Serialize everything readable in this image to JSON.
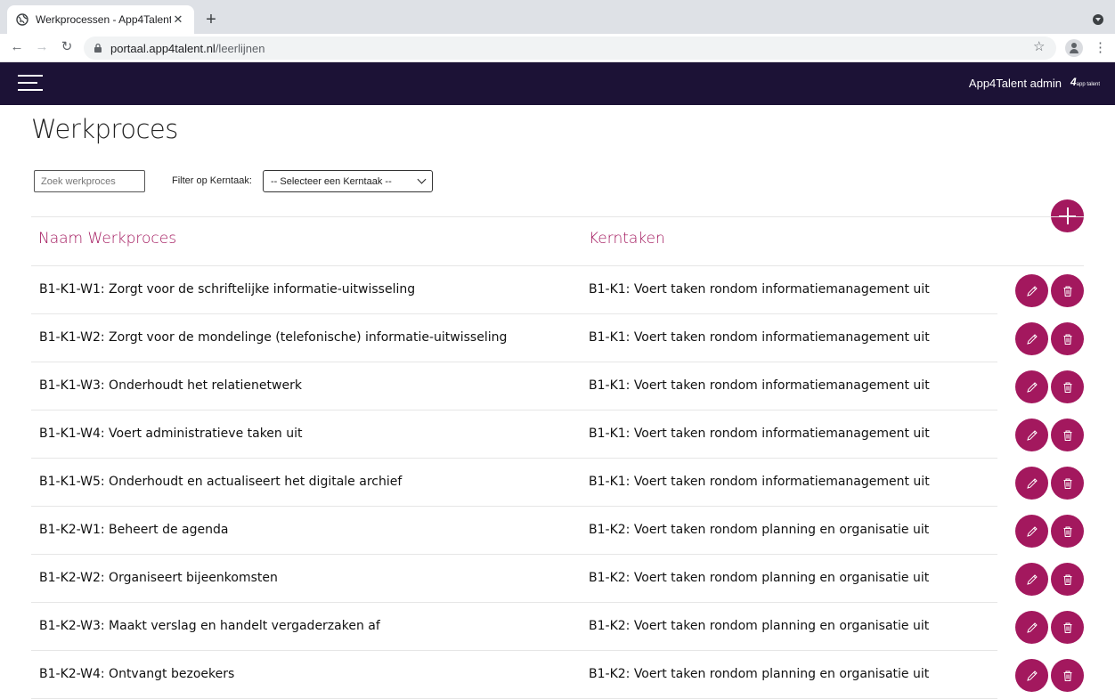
{
  "browser": {
    "tab_title": "Werkprocessen - App4Talent",
    "close_glyph": "✕",
    "new_tab_glyph": "+",
    "url_host": "portaal.app4talent.nl",
    "url_path": "/leerlijnen",
    "back_glyph": "←",
    "forward_glyph": "→",
    "reload_glyph": "↻",
    "star_glyph": "☆",
    "menu_glyph": "⋮"
  },
  "header": {
    "admin_name": "App4Talent admin",
    "logo_text": "4",
    "logo_small": "app talent"
  },
  "page": {
    "title": "Werkproces",
    "search_placeholder": "Zoek werkproces",
    "filter_label": "Filter op Kerntaak:",
    "filter_selected": "-- Selecteer een Kerntaak --"
  },
  "table": {
    "col_name": "Naam Werkproces",
    "col_kerntaak": "Kerntaken",
    "rows": [
      {
        "name": "B1-K1-W1: Zorgt voor de schriftelijke informatie-uitwisseling",
        "kerntaak": "B1-K1: Voert taken rondom informatiemanagement uit"
      },
      {
        "name": "B1-K1-W2: Zorgt voor de mondelinge (telefonische) informatie-uitwisseling",
        "kerntaak": "B1-K1: Voert taken rondom informatiemanagement uit"
      },
      {
        "name": "B1-K1-W3: Onderhoudt het relatienetwerk",
        "kerntaak": "B1-K1: Voert taken rondom informatiemanagement uit"
      },
      {
        "name": "B1-K1-W4: Voert administratieve taken uit",
        "kerntaak": "B1-K1: Voert taken rondom informatiemanagement uit"
      },
      {
        "name": "B1-K1-W5: Onderhoudt en actualiseert het digitale archief",
        "kerntaak": "B1-K1: Voert taken rondom informatiemanagement uit"
      },
      {
        "name": "B1-K2-W1: Beheert de agenda",
        "kerntaak": "B1-K2: Voert taken rondom planning en organisatie uit"
      },
      {
        "name": "B1-K2-W2: Organiseert bijeenkomsten",
        "kerntaak": "B1-K2: Voert taken rondom planning en organisatie uit"
      },
      {
        "name": "B1-K2-W3: Maakt verslag en handelt vergaderzaken af",
        "kerntaak": "B1-K2: Voert taken rondom planning en organisatie uit"
      },
      {
        "name": "B1-K2-W4: Ontvangt bezoekers",
        "kerntaak": "B1-K2: Voert taken rondom planning en organisatie uit"
      }
    ]
  },
  "colors": {
    "accent": "#a3185e",
    "appbar": "#1c1236"
  }
}
